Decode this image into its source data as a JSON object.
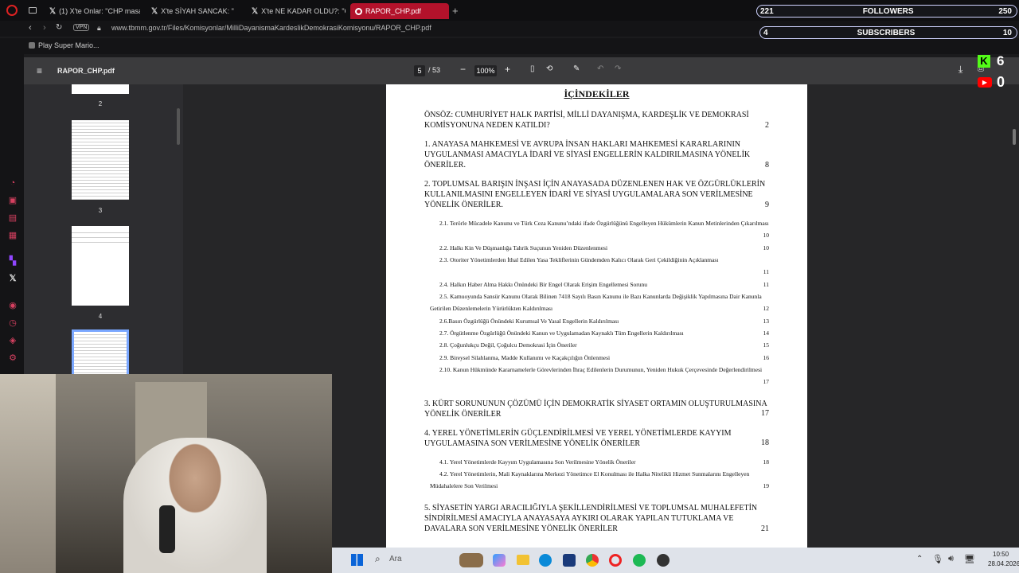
{
  "tabs": [
    {
      "label": "(1) X'te Onlar: \"CHP masar",
      "icon": "x-logo-icon",
      "active": false
    },
    {
      "label": "X'te SİYAH SANCAK: \"",
      "icon": "x-logo-icon",
      "active": false
    },
    {
      "label": "X'te NE KADAR OLDU?: \"C",
      "icon": "x-logo-icon",
      "active": false
    },
    {
      "label": "RAPOR_CHP.pdf",
      "icon": "opera-icon",
      "active": true
    }
  ],
  "address": {
    "vpn_badge": "VPN",
    "url": "www.tbmm.gov.tr/Files/Komisyonlar/MilliDayanismaKardeslikDemokrasiKomisyonu/RAPOR_CHP.pdf"
  },
  "bookmark": "Play Super Mario...",
  "social": {
    "followers_count": "221",
    "followers_label": "FOLLOWERS",
    "followers_right": "250",
    "subscribers_count": "4",
    "subscribers_label": "SUBSCRIBERS",
    "subscribers_right": "10",
    "kick_count": "6",
    "youtube_count": "0"
  },
  "pdf": {
    "filename": "RAPOR_CHP.pdf",
    "current_page": "5",
    "total_pages": "/ 53",
    "zoom": "100%"
  },
  "thumbnails": [
    {
      "number": "2"
    },
    {
      "number": "3"
    },
    {
      "number": "4"
    }
  ],
  "toc": {
    "title": "İÇİNDEKİLER",
    "entries": [
      {
        "text": "ÖNSÖZ: CUMHURİYET HALK PARTİSİ, MİLLİ DAYANIŞMA, KARDEŞLİK VE DEMOKRASİ KOMİSYONUNA NEDEN KATILDI?",
        "page": "2"
      },
      {
        "text": "1. ANAYASA MAHKEMESİ VE AVRUPA İNSAN HAKLARI MAHKEMESİ KARARLARININ UYGULANMASI AMACIYLA İDARİ VE SİYASİ ENGELLERİN KALDIRILMASINA YÖNELİK ÖNERİLER.",
        "page": "8"
      },
      {
        "text": "2. TOPLUMSAL BARIŞIN İNŞASI İÇİN ANAYASADA DÜZENLENEN HAK VE ÖZGÜRLÜKLERİN KULLANILMASINI ENGELLEYEN İDARİ VE SİYASİ UYGULAMALARA SON VERİLMESİNE YÖNELİK ÖNERİLER.",
        "page": "9"
      },
      {
        "text": "2.1. Terörle Mücadele Kanunu ve Türk Ceza Kanunu’ndaki ifade Özgürlüğünü Engelleyen Hükümlerin Kanun Metinlerinden Çıkarılması",
        "page": "10"
      },
      {
        "text": "2.2. Halkı Kin Ve Düşmanlığa Tahrik Suçunun Yeniden Düzenlenmesi",
        "page": "10"
      },
      {
        "text": "2.3. Otoriter Yönetimlerden İthal Edilen Yasa Tekliflerinin Gündemden Kalıcı Olarak Geri Çekildiğinin Açıklanması",
        "page": "11"
      },
      {
        "text": "2.4. Halkın Haber Alma Hakkı Önündeki Bir Engel Olarak Erişim Engellemesi Sorunu",
        "page": "11"
      },
      {
        "text": "2.5. Kamuoyunda Sansür Kanunu Olarak Bilinen 7418 Sayılı Basın Kanunu ile Bazı Kanunlarda Değişiklik Yapılmasına Dair Kanunla Getirilen Düzenlemelerin Yürürlükten Kaldırılması",
        "page": "12"
      },
      {
        "text": "2.6.Basın Özgürlüğü Önündeki Kurumsal Ve Yasal Engellerin Kaldırılması",
        "page": "13"
      },
      {
        "text": "2.7. Örgütlenme Özgürlüğü Önündeki Kanun ve Uygulamadan Kaynaklı Tüm Engellerin Kaldırılması",
        "page": "14"
      },
      {
        "text": "2.8. Çoğunlukçu Değil, Çoğulcu Demokrasi İçin Öneriler",
        "page": "15"
      },
      {
        "text": "2.9. Bireysel Silahlanma, Madde Kullanımı ve Kaçakçılığın Önlenmesi",
        "page": "16"
      },
      {
        "text": "2.10. Kanun Hükmünde Kararnamelerle Görevlerinden İhraç Edilenlerin Durumunun, Yeniden Hukuk Çerçevesinde Değerlendirilmesi",
        "page": "17"
      },
      {
        "text": "3. KÜRT SORUNUNUN ÇÖZÜMÜ İÇİN DEMOKRATİK SİYASET ORTAMIN OLUŞTURULMASINA YÖNELİK ÖNERİLER",
        "page": "17"
      },
      {
        "text": "4. YEREL YÖNETİMLERİN GÜÇLENDİRİLMESİ VE YEREL YÖNETİMLERDE KAYYIM UYGULAMASINA SON VERİLMESİNE YÖNELİK ÖNERİLER",
        "page": "18"
      },
      {
        "text": "4.1. Yerel Yönetimlerde Kayyım Uygulamasına Son Verilmesine Yönelik Öneriler",
        "page": "18"
      },
      {
        "text": "4.2. Yerel Yönetimlerin, Mali Kaynaklarına Merkezi Yönetimce El Konulması ile Halka Nitelikli Hizmet Sunmalarını Engelleyen Müdahalelere Son Verilmesi",
        "page": "19"
      },
      {
        "text": "5. SİYASETİN YARGI ARACILIĞIYLA ŞEKİLLENDİRİLMESİ VE TOPLUMSAL MUHALEFETİN SİNDİRİLMESİ AMACIYLA ANAYASAYA AYKIRI OLARAK YAPILAN TUTUKLAMA VE DAVALARA SON VERİLMESİNE YÖNELİK ÖNERİLER",
        "page": "21"
      }
    ]
  },
  "taskbar": {
    "search_placeholder": "Ara",
    "time": "10:50",
    "date": "28.04.2026"
  },
  "colors": {
    "accent": "#b3122b",
    "kick": "#53fc18",
    "youtube": "#ff0000"
  }
}
